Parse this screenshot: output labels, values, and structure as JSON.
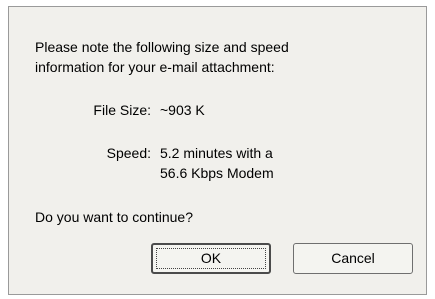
{
  "dialog": {
    "message_line1": "Please note the following size and speed",
    "message_line2": "information for your e-mail attachment:",
    "file_size": {
      "label": "File Size:",
      "value": "~903 K"
    },
    "speed": {
      "label": "Speed:",
      "value_line1": "5.2 minutes with a",
      "value_line2": "56.6 Kbps Modem"
    },
    "question": "Do you want to continue?",
    "buttons": {
      "ok_label": "OK",
      "cancel_label": "Cancel"
    }
  }
}
